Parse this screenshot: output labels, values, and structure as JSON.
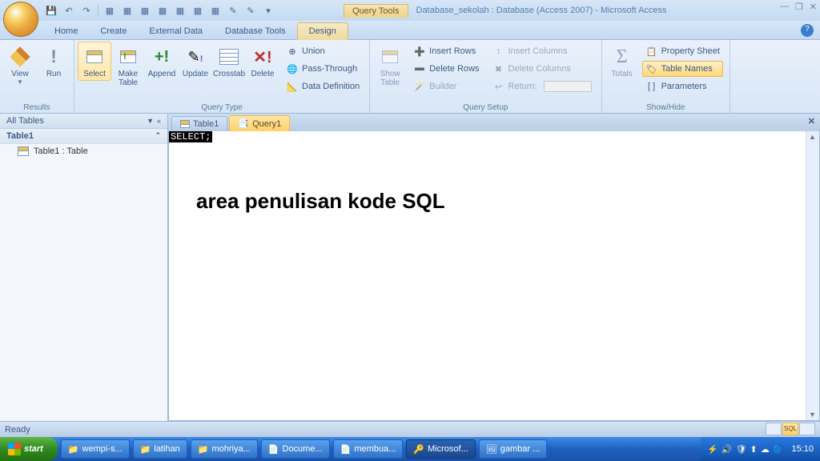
{
  "title": {
    "context_label": "Query Tools",
    "app_title": "Database_sekolah : Database (Access 2007) - Microsoft Access"
  },
  "tabs": {
    "home": "Home",
    "create": "Create",
    "external": "External Data",
    "dbtools": "Database Tools",
    "design": "Design"
  },
  "ribbon": {
    "results": {
      "label": "Results",
      "view": "View",
      "run": "Run"
    },
    "query_type": {
      "label": "Query Type",
      "select": "Select",
      "make_table": "Make\nTable",
      "append": "Append",
      "update": "Update",
      "crosstab": "Crosstab",
      "delete": "Delete",
      "union": "Union",
      "passthrough": "Pass-Through",
      "datadef": "Data Definition"
    },
    "query_setup": {
      "label": "Query Setup",
      "show_table": "Show\nTable",
      "insert_rows": "Insert Rows",
      "delete_rows": "Delete Rows",
      "builder": "Builder",
      "insert_cols": "Insert Columns",
      "delete_cols": "Delete Columns",
      "return": "Return:"
    },
    "show_hide": {
      "label": "Show/Hide",
      "totals": "Totals",
      "property_sheet": "Property Sheet",
      "table_names": "Table Names",
      "parameters": "Parameters"
    }
  },
  "nav": {
    "header": "All Tables",
    "group": "Table1",
    "item1": "Table1 : Table"
  },
  "doc": {
    "tab1": "Table1",
    "tab2": "Query1",
    "sql": "SELECT;",
    "annotation": "area penulisan kode SQL"
  },
  "status": {
    "ready": "Ready"
  },
  "taskbar": {
    "start": "start",
    "items": [
      "wempi-s...",
      "latihan",
      "mohriya...",
      "Docume...",
      "membua...",
      "Microsof...",
      "gambar ..."
    ],
    "clock": "15:10"
  }
}
